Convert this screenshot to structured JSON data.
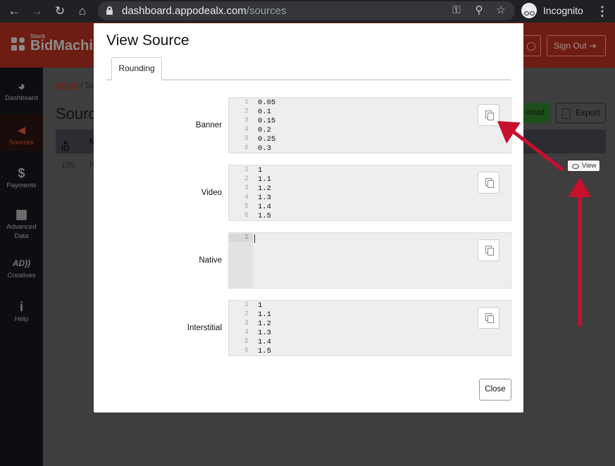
{
  "browser": {
    "url_domain": "dashboard.appodealx.com",
    "url_path": "/sources",
    "profile_label": "Incognito"
  },
  "app": {
    "logo_small": "Stack",
    "logo_text": "BidMachi",
    "signout_label": "Sign Out",
    "sidebar": [
      {
        "label": "Dashboard",
        "icon": "dashboard-icon"
      },
      {
        "label": "Sources",
        "icon": "megaphone-icon",
        "active": true
      },
      {
        "label": "Payments",
        "icon": "dollar-icon"
      },
      {
        "label": "Advanced Data",
        "icon": "cubes-icon"
      },
      {
        "label": "Creatives",
        "icon": "ad-icon"
      },
      {
        "label": "Help",
        "icon": "info-icon"
      }
    ],
    "breadcrumb_home": "Home",
    "breadcrumb_rest": " / So",
    "page_title": "Sourc",
    "reload_label": "eload",
    "export_label": "Export",
    "table_headers": {
      "id": "ID",
      "name": "N"
    },
    "row": {
      "id": "135",
      "name_fragment": "P"
    },
    "view_label": "View"
  },
  "modal": {
    "title": "View Source",
    "tab_label": "Rounding",
    "fields": [
      {
        "label": "Banner",
        "lines": [
          "0.05",
          "0.1",
          "0.15",
          "0.2",
          "0.25",
          "0.3"
        ]
      },
      {
        "label": "Video",
        "lines": [
          "1",
          "1.1",
          "1.2",
          "1.3",
          "1.4",
          "1.5"
        ]
      },
      {
        "label": "Native",
        "lines": [
          ""
        ]
      },
      {
        "label": "Interstitial",
        "lines": [
          "1",
          "1.1",
          "1.2",
          "1.3",
          "1.4",
          "1.5"
        ]
      }
    ],
    "close_label": "Close"
  },
  "colors": {
    "annotation_arrow": "#c8102e",
    "header_dimmed": "#6e1d12",
    "sidebar_bg": "#0c0e12"
  }
}
